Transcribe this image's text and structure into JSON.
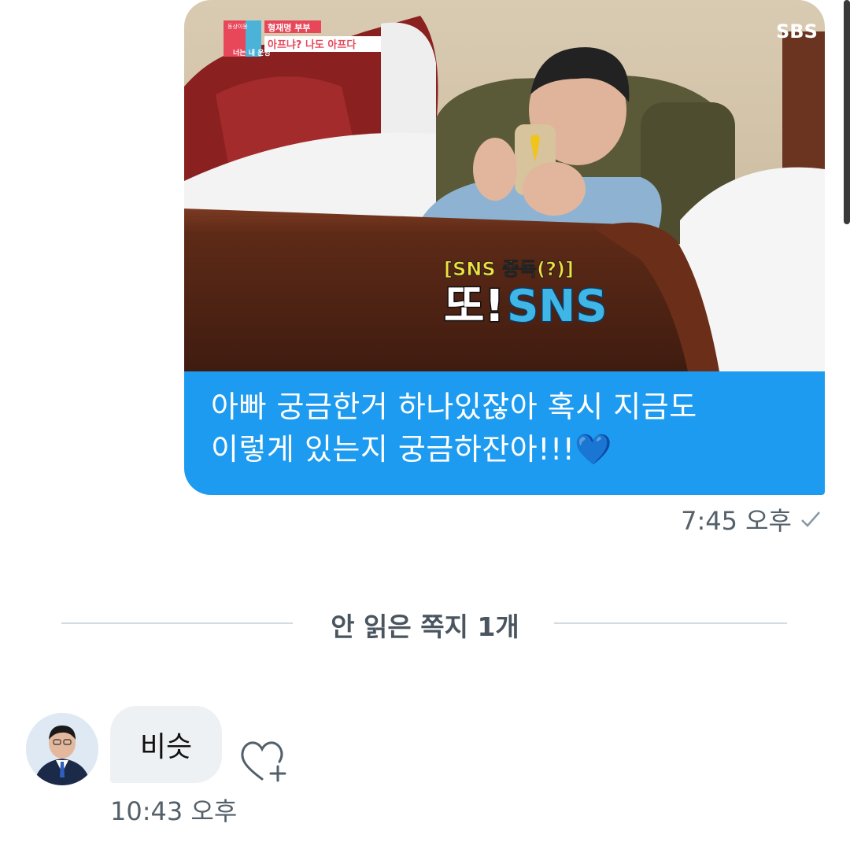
{
  "sent_message": {
    "media": {
      "network_logo": "SBS",
      "program_tag": "동상이몽",
      "program_name": "너는 내 운명",
      "caption_top_1": "형재명 부부",
      "caption_top_2": "아프냐? 나도 아프다",
      "caption_sub": "[SNS 중독(?)]",
      "caption_main_1": "또!",
      "caption_main_2": "SNS"
    },
    "text_line1": "아빠 궁금한거 하나있잖아 혹시 지금도",
    "text_line2": "이렇게 있는지 궁금하잔아!!!",
    "heart_emoji": "💙",
    "time": "7:45 오후",
    "status_icon": "check-icon",
    "bubble_color": "#1d9bf0"
  },
  "divider": {
    "label": "안 읽은 쪽지 1개"
  },
  "received_message": {
    "text": "비슷",
    "time": "10:43 오후",
    "reaction_icon": "add-reaction-heart-icon"
  }
}
